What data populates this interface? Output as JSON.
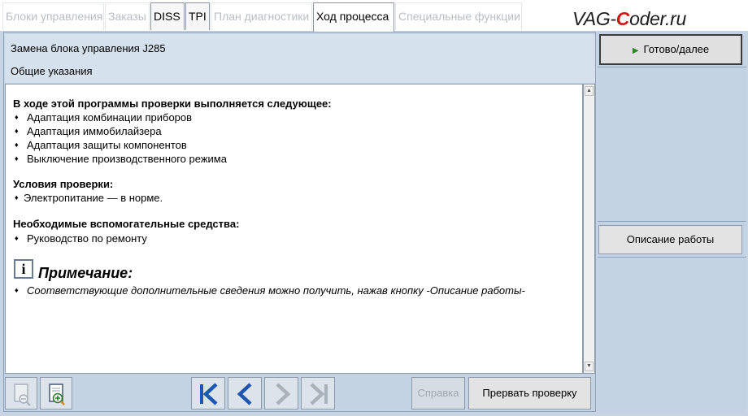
{
  "tabs": [
    {
      "label": "Блоки управления",
      "state": "disabled"
    },
    {
      "label": "Заказы",
      "state": "disabled"
    },
    {
      "label": "DISS",
      "state": "enabled"
    },
    {
      "label": "TPI",
      "state": "enabled"
    },
    {
      "label": "План диагностики",
      "state": "disabled"
    },
    {
      "label": "Ход процесса",
      "state": "active"
    },
    {
      "label": "Специальные функции",
      "state": "disabled"
    }
  ],
  "logo": {
    "prefix": "VAG-",
    "c": "C",
    "suffix": "oder.ru"
  },
  "header": {
    "title": "Замена блока управления J285",
    "subtitle": "Общие указания"
  },
  "content": {
    "section1": {
      "heading": "В ходе этой программы проверки выполняется следующее:",
      "items": [
        "Адаптация комбинации приборов",
        "Адаптация иммобилайзера",
        "Адаптация защиты компонентов",
        "Выключение производственного режима"
      ]
    },
    "section2": {
      "heading": "Условия проверки:",
      "items": [
        "Электропитание — в норме."
      ]
    },
    "section3": {
      "heading": "Необходимые вспомогательные средства:",
      "items": [
        "Руководство по ремонту"
      ]
    },
    "note": {
      "icon_char": "i",
      "title": "Примечание:",
      "items": [
        "Соответствующие дополнительные сведения можно получить, нажав кнопку -Описание работы-"
      ]
    },
    "bullet_char": "♦"
  },
  "toolbar": {
    "help_label": "Справка",
    "abort_label": "Прервать проверку"
  },
  "right": {
    "ready_label": "Готово/далее",
    "description_label": "Описание работы"
  },
  "colors": {
    "accent": "#1e56b4",
    "disabled_icon": "#a9b1ba",
    "play_green": "#2a8a2a"
  }
}
